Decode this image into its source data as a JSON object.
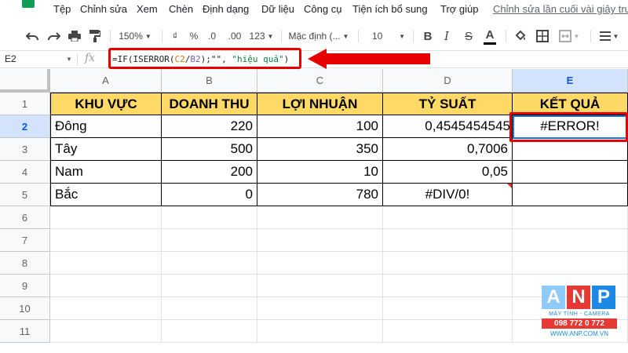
{
  "menu": {
    "items": [
      "Tệp",
      "Chỉnh sửa",
      "Xem",
      "Chèn",
      "Định dạng",
      "Dữ liệu",
      "Công cụ",
      "Tiện ích bổ sung",
      "Trợ giúp"
    ],
    "last_edit": "Chỉnh sửa lần cuối vài giây trư"
  },
  "toolbar": {
    "zoom": "150%",
    "currency": "₫",
    "percent": "%",
    "decimal_decrease": ".0",
    "decimal_increase": ".00",
    "more_formats": "123",
    "font": "Mặc định (...",
    "font_size": "10",
    "bold": "B",
    "italic": "I",
    "strikethrough": "S",
    "text_color": "A",
    "text_color_value": "#000000"
  },
  "formula_bar": {
    "name_box": "E2",
    "fx": "fx",
    "formula_parts": [
      "=IF(ISERROR(",
      "C2",
      "/",
      "B2",
      ");\"\", ",
      "\"hiệu quả\"",
      ")"
    ]
  },
  "sheet": {
    "columns": [
      "A",
      "B",
      "C",
      "D",
      "E"
    ],
    "selected_column": "E",
    "rows": [
      "1",
      "2",
      "3",
      "4",
      "5",
      "6",
      "7",
      "8",
      "9",
      "10",
      "11"
    ],
    "selected_row": "2",
    "headers": [
      "KHU VỰC",
      "DOANH THU",
      "LỢI NHUẬN",
      "TỶ SUẤT",
      "KẾT QUẢ"
    ],
    "data": [
      [
        "Đông",
        "220",
        "100",
        "0,4545454545",
        "#ERROR!"
      ],
      [
        "Tây",
        "500",
        "350",
        "0,7006",
        ""
      ],
      [
        "Nam",
        "200",
        "10",
        "0,05",
        ""
      ],
      [
        "Bắc",
        "0",
        "780",
        "#DIV/0!",
        ""
      ]
    ],
    "header_fill": "#ffd966",
    "annotation_color": "#e60000"
  },
  "watermark": {
    "letters": [
      "A",
      "N",
      "P"
    ],
    "letter_colors": [
      "#90caf9",
      "#e53935",
      "#1e88e5"
    ],
    "tagline": "MÁY TÍNH - CAMERA",
    "phone": "098 772 0 772",
    "website": "WWW.ANP.COM.VN"
  }
}
